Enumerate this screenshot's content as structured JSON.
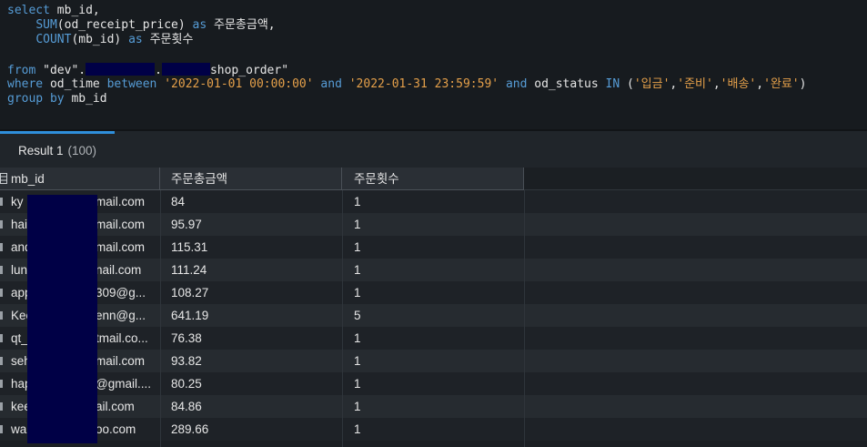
{
  "editor": {
    "line1": {
      "kw1": "select",
      "rest": " mb_id,"
    },
    "line2": {
      "fn": "SUM",
      "args": "(od_receipt_price)",
      "kw": "as",
      "alias": "주문총금액,"
    },
    "line3": {
      "fn": "COUNT",
      "args": "(mb_id)",
      "kw": "as",
      "alias": "주문횟수"
    },
    "line5": {
      "kw": "from",
      "s1": "\"dev\".",
      "s2": ".",
      "s3": "shop_order\""
    },
    "line6": {
      "kw_where": "where",
      "col": "od_time",
      "kw_between": "between",
      "d1": "'2022-01-01 00:00:00'",
      "kw_and1": "and",
      "d2": "'2022-01-31 23:59:59'",
      "kw_and2": "and",
      "col2": "od_status",
      "kw_in": "IN",
      "open": "(",
      "v1": "'입금'",
      "v2": "'준비'",
      "v3": "'배송'",
      "v4": "'완료'",
      "close": ")"
    },
    "line7": {
      "kw": "group by",
      "col": "mb_id"
    }
  },
  "result_tab": {
    "label": "Result 1",
    "count": "(100)"
  },
  "grid": {
    "columns": [
      "mb_id",
      "주문총금액",
      "주문횟수"
    ],
    "rows": [
      [
        "ky",
        "mail.com",
        "84",
        "1"
      ],
      [
        "hai",
        "mail.com",
        "95.97",
        "1"
      ],
      [
        "and",
        "mail.com",
        "115.31",
        "1"
      ],
      [
        "lun",
        "nail.com",
        "111.24",
        "1"
      ],
      [
        "app",
        "309@g...",
        "108.27",
        "1"
      ],
      [
        "Kee",
        "enn@g...",
        "641.19",
        "5"
      ],
      [
        "qt_",
        "tmail.co...",
        "76.38",
        "1"
      ],
      [
        "seh",
        "mail.com",
        "93.82",
        "1"
      ],
      [
        "hap",
        "@gmail....",
        "80.25",
        "1"
      ],
      [
        "kee",
        "ail.com",
        "84.86",
        "1"
      ],
      [
        "wa",
        "oo.com",
        "289.66",
        "1"
      ]
    ]
  },
  "icons": {
    "table": "table-icon",
    "row": "row-marker-icon"
  },
  "colors": {
    "keyword": "#569cd6",
    "string": "#e5a04a",
    "tab_accent": "#2f8fdc",
    "redaction": "#000046"
  }
}
